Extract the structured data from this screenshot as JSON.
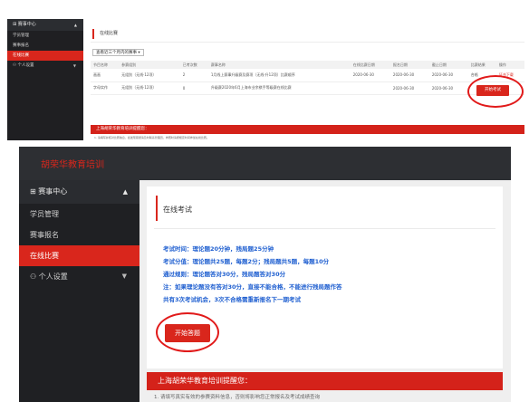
{
  "top": {
    "sidebar": {
      "header": "赛事中心",
      "items": [
        "学员管理",
        "赛事报名",
        "在线比赛"
      ],
      "settings": "个人设置"
    },
    "title": "在线比赛",
    "filter": "查看近三个月内的赛事 ▾",
    "table": {
      "columns": [
        "节目名称",
        "参赛组别",
        "已考次数",
        "赛事名称",
        "在线比赛日期",
        "报名日期",
        "截止日期",
        "比赛结果",
        "操作"
      ],
      "rows": [
        [
          "画画",
          "无组别（无线·12项）",
          "2",
          "1月线上赛事升级赛及赛项（无线·升12项）比赛顺序",
          "2020-06-30",
          "2020-06-30",
          "2020-06-30",
          "合格",
          "证书下载"
        ],
        [
          "字母实作",
          "无组别（无线·12项）",
          "0",
          "升级赛2020年6月上海市业余棋手等级赛在线比赛",
          "",
          "2020-06-30",
          "2020-06-30",
          "",
          ""
        ]
      ]
    },
    "start_button": "开始考试",
    "reminder": "上海胡荣华教育培训提醒您：",
    "reminder_text": "1. 请填写并核对比赛信息，如发现错误请及时联系管理员，参赛时请按规定时间参加在线比赛。"
  },
  "bottom": {
    "brand": "胡荣华教育培训",
    "sidebar": {
      "header": "赛事中心",
      "items": [
        "学员管理",
        "赛事报名",
        "在线比赛"
      ],
      "settings": "个人设置"
    },
    "title": "在线考试",
    "rules": [
      "考试时间：理论题20分钟，残局题25分钟",
      "考试分值：理论题共25题，每题2分；残局题共5题，每题10分",
      "通过规则：理论题答对30分，残局题答对30分",
      "注：如果理论题没有答对30分，直接不能合格，不能进行残局题作答",
      "共有3次考试机会，3次不合格需重新报名下一期考试"
    ],
    "start_button": "开始答题",
    "reminder": "上海胡荣华教育培训提醒您：",
    "reminder_text": "1. 请填写真实有效的参赛资料信息，否则将影响您正常报名及考试成绩查询"
  }
}
